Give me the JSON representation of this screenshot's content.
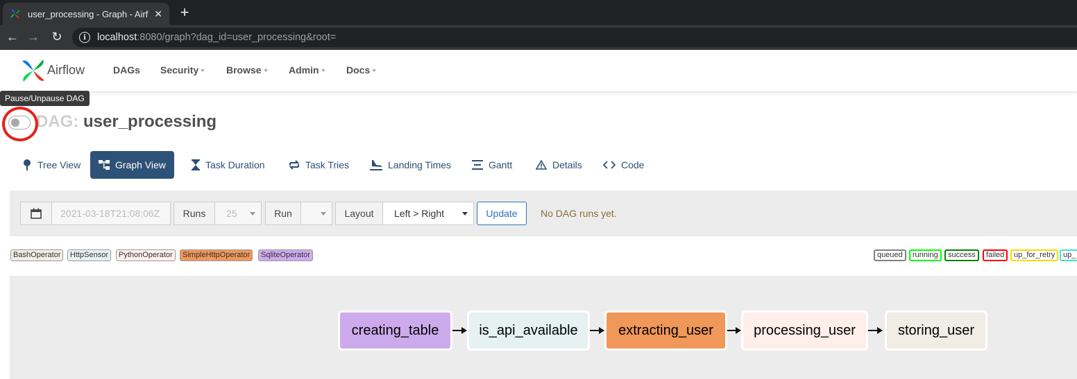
{
  "browser": {
    "tab_title": "user_processing - Graph - Airflow",
    "new_tab_symbol": "+",
    "close_symbol": "✕",
    "url_host": "localhost",
    "url_rest": ":8080/graph?dag_id=user_processing&root="
  },
  "airflow_nav": {
    "brand": "Airflow",
    "menu": [
      "DAGs",
      "Security",
      "Browse",
      "Admin",
      "Docs"
    ]
  },
  "tooltip": "Pause/Unpause DAG",
  "dag": {
    "prefix": "DAG:",
    "name": "user_processing",
    "paused": true
  },
  "view_tabs": [
    {
      "label": "Tree View",
      "icon": "tree-icon",
      "active": false
    },
    {
      "label": "Graph View",
      "icon": "graph-icon",
      "active": true
    },
    {
      "label": "Task Duration",
      "icon": "hourglass-icon",
      "active": false
    },
    {
      "label": "Task Tries",
      "icon": "retry-icon",
      "active": false
    },
    {
      "label": "Landing Times",
      "icon": "landing-icon",
      "active": false
    },
    {
      "label": "Gantt",
      "icon": "gantt-icon",
      "active": false
    },
    {
      "label": "Details",
      "icon": "warning-icon",
      "active": false
    },
    {
      "label": "Code",
      "icon": "code-icon",
      "active": false
    }
  ],
  "controls": {
    "date_value": "2021-03-18T21:08:06Z",
    "runs_label": "Runs",
    "runs_value": "25",
    "run_label": "Run",
    "run_value": "",
    "layout_label": "Layout",
    "layout_value": "Left > Right",
    "update_label": "Update",
    "status_message": "No DAG runs yet."
  },
  "operator_legend": [
    {
      "label": "BashOperator",
      "color": "#f0ede4"
    },
    {
      "label": "HttpSensor",
      "color": "#e6f1f2"
    },
    {
      "label": "PythonOperator",
      "color": "#ffefeb"
    },
    {
      "label": "SimpleHttpOperator",
      "color": "#f0975a"
    },
    {
      "label": "SqliteOperator",
      "color": "#cdaaed"
    }
  ],
  "state_legend": [
    {
      "label": "queued",
      "color": "#808080"
    },
    {
      "label": "running",
      "color": "#00ff00"
    },
    {
      "label": "success",
      "color": "#008000"
    },
    {
      "label": "failed",
      "color": "#ff0000"
    },
    {
      "label": "up_for_retry",
      "color": "#ffd700"
    },
    {
      "label": "up_",
      "color": "#40e0d0"
    }
  ],
  "graph": {
    "nodes": [
      {
        "label": "creating_table",
        "color": "#cdaaed"
      },
      {
        "label": "is_api_available",
        "color": "#e6f1f2"
      },
      {
        "label": "extracting_user",
        "color": "#f0975a"
      },
      {
        "label": "processing_user",
        "color": "#ffefeb"
      },
      {
        "label": "storing_user",
        "color": "#f0ede4"
      }
    ]
  }
}
